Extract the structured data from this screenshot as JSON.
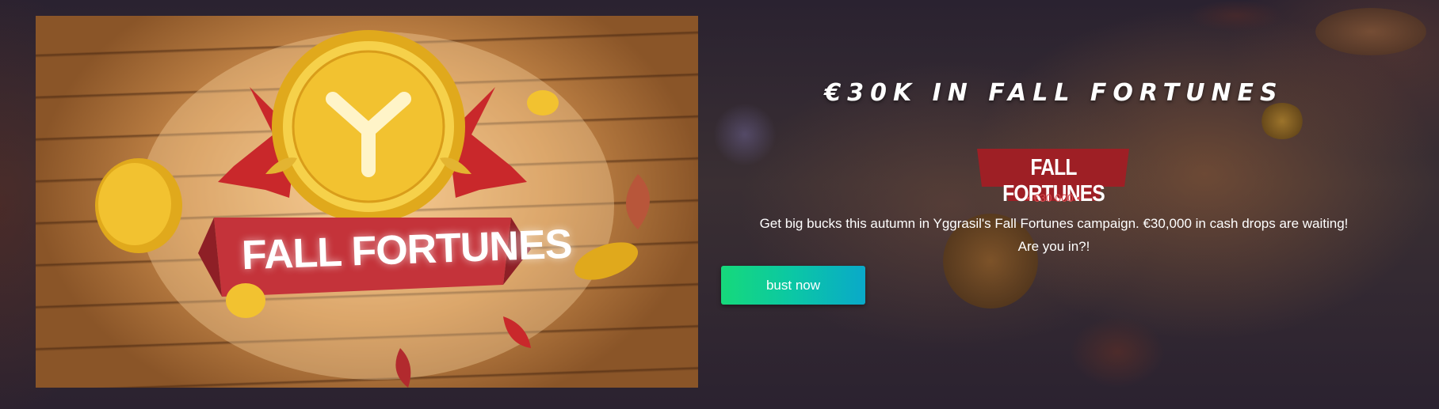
{
  "promo": {
    "image_banner_text": "FALL FORTUNES",
    "title": "€30K IN FALL FORTUNES",
    "logo": {
      "name": "FALL FORTUNES",
      "amount": "• €30 000 •"
    },
    "description_line1": "Get big bucks this autumn in Yggrasil's Fall Fortunes campaign. €30,000 in cash drops are waiting!",
    "description_line2": "Are you in?!",
    "cta_label": "bust now"
  },
  "colors": {
    "background": "#1f1a2b",
    "ribbon_red": "#c4333a",
    "coin_gold": "#f2c230",
    "cta_start": "#16d97b",
    "cta_end": "#0aa9c9"
  }
}
